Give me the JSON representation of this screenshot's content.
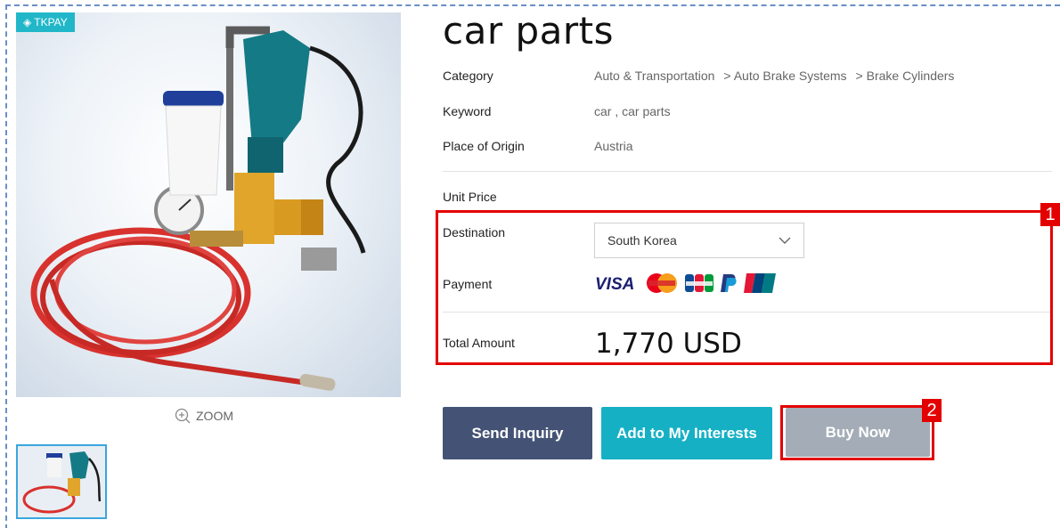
{
  "badge": {
    "prefix": "◈",
    "label": "TKPAY"
  },
  "zoom_label": "ZOOM",
  "product": {
    "title": "car parts",
    "category_label": "Category",
    "category_path": [
      "Auto & Transportation",
      "> Auto Brake Systems",
      "> Brake Cylinders"
    ],
    "keyword_label": "Keyword",
    "keyword_value": "car , car parts",
    "origin_label": "Place of Origin",
    "origin_value": "Austria",
    "unit_price_label": "Unit Price",
    "destination_label": "Destination",
    "destination_value": "South Korea",
    "payment_label": "Payment",
    "payment_methods": [
      "VISA",
      "MasterCard",
      "JCB",
      "PayPal",
      "UnionPay"
    ],
    "total_label": "Total Amount",
    "total_value": "1,770 USD"
  },
  "actions": {
    "inquiry": "Send Inquiry",
    "interests": "Add to My Interests",
    "buy": "Buy Now"
  },
  "annotations": {
    "box1": "1",
    "box2": "2"
  },
  "colors": {
    "accent_red": "#e30000",
    "inquiry_bg": "#445375",
    "interests_bg": "#16b0c5",
    "buy_bg": "#a4acb7",
    "badge_bg": "#21b7c9"
  }
}
